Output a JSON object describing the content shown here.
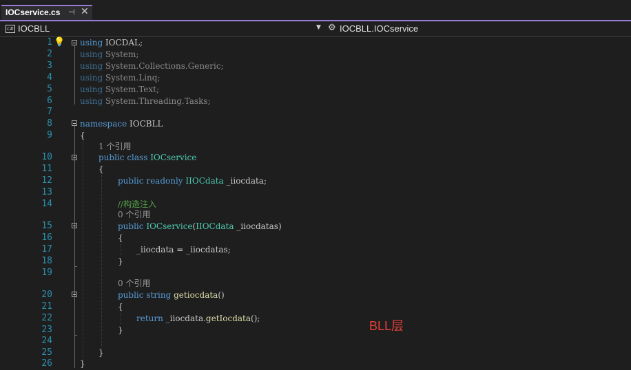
{
  "tab": {
    "title": "IOCservice.cs",
    "pin_glyph": "⊣",
    "close_glyph": "✕"
  },
  "navbar": {
    "left_label": "IOCBLL",
    "left_icon": "c#",
    "right_label": "IOCBLL.IOCservice",
    "right_icon": "type-icon"
  },
  "line_numbers": [
    "1",
    "2",
    "3",
    "4",
    "5",
    "6",
    "7",
    "8",
    "9",
    "10",
    "11",
    "12",
    "13",
    "14",
    "15",
    "16",
    "17",
    "18",
    "19",
    "20",
    "21",
    "22",
    "23",
    "24",
    "25",
    "26"
  ],
  "code": {
    "l1_kw": "using",
    "l1_rest": " IOCDAL;",
    "l2_kw": "using",
    "l2_rest": " System;",
    "l3_kw": "using",
    "l3_rest": " System.Collections.Generic;",
    "l4_kw": "using",
    "l4_rest": " System.Linq;",
    "l5_kw": "using",
    "l5_rest": " System.Text;",
    "l6_kw": "using",
    "l6_rest": " System.Threading.Tasks;",
    "l8_kw": "namespace",
    "l8_rest": " IOCBLL",
    "l9": "{",
    "cl_class": "1 个引用",
    "l10_kw1": "public",
    "l10_kw2": "class",
    "l10_type": "IOCservice",
    "l11": "{",
    "l12_kw1": "public",
    "l12_kw2": "readonly",
    "l12_type": "IIOCdata",
    "l12_rest": " _iiocdata;",
    "l14_comment": "//构造注入",
    "cl_ctor": "0 个引用",
    "l15_kw": "public",
    "l15_type": "IOCservice",
    "l15_p1": "(",
    "l15_ptype": "IIOCdata",
    "l15_rest": " _iiocdatas)",
    "l16": "{",
    "l17": "_iiocdata = _iiocdatas;",
    "l18": "}",
    "cl_method": "0 个引用",
    "l20_kw1": "public",
    "l20_kw2": "string",
    "l20_fn": "getiocdata",
    "l20_rest": "()",
    "l21": "{",
    "l22_kw": "return",
    "l22_rest1": " _iiocdata.",
    "l22_fn": "getIocdata",
    "l22_rest2": "();",
    "l23": "}",
    "l25": "}",
    "l26": "}"
  },
  "annotation": "BLL层",
  "colors": {
    "accent": "#9a7cd6",
    "keyword": "#569cd6",
    "type": "#4ec9b0",
    "comment": "#57a64a",
    "line_number": "#2b91af",
    "annotation": "#e8403a"
  }
}
